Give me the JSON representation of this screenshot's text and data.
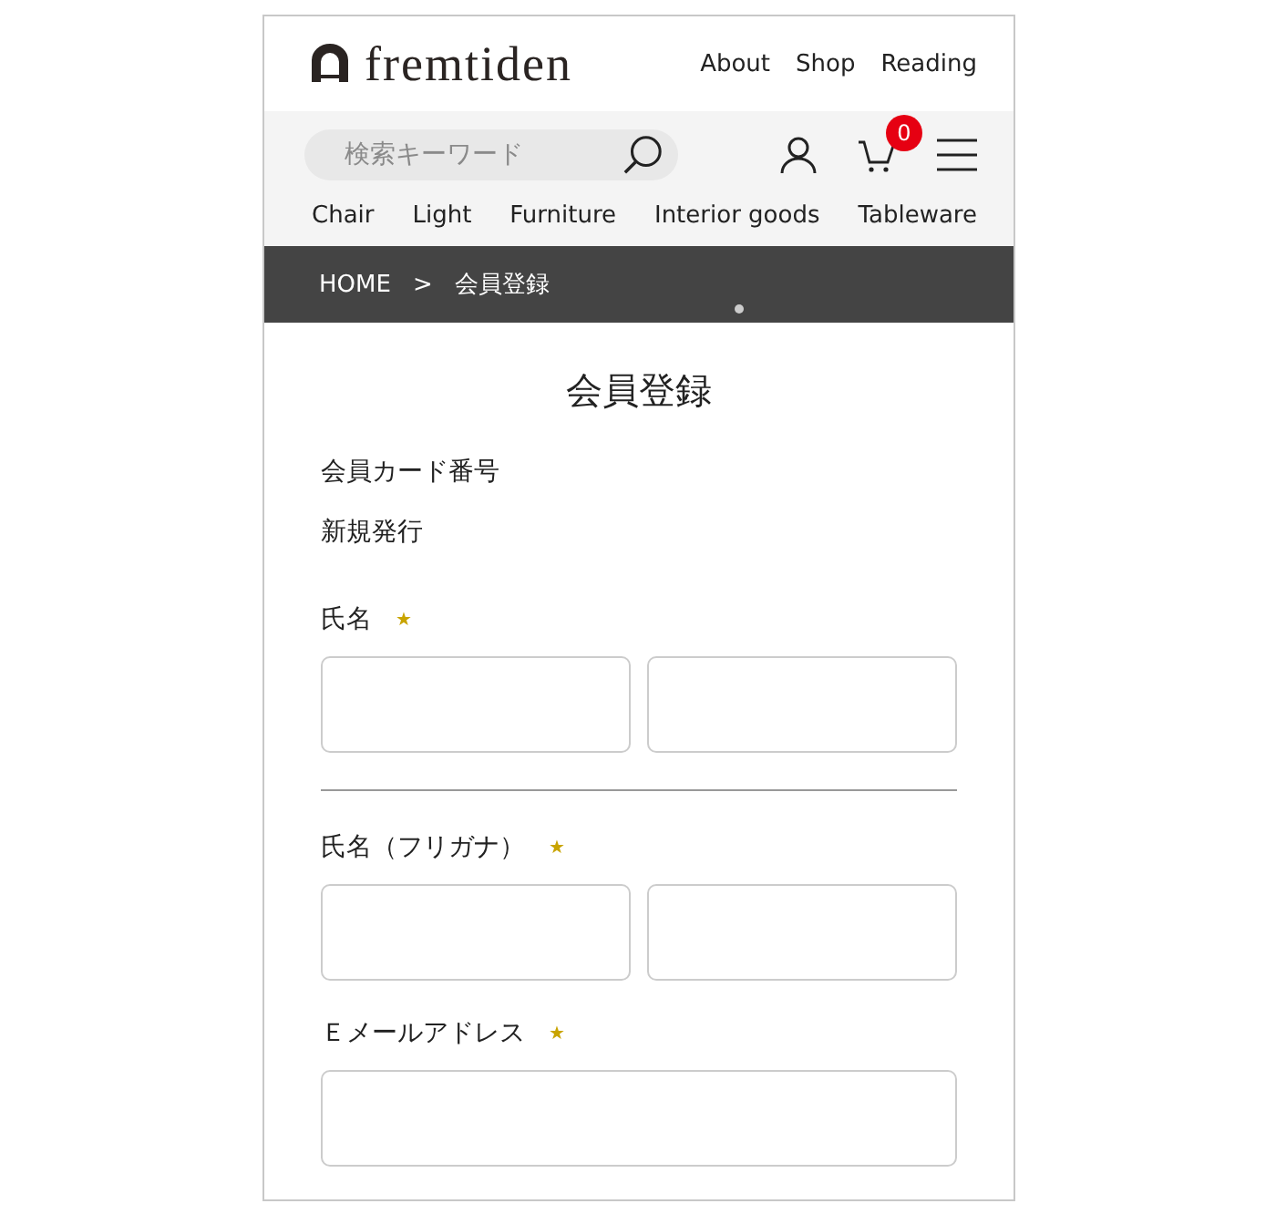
{
  "header": {
    "logo": "fremtiden",
    "nav": [
      "About",
      "Shop",
      "Reading"
    ]
  },
  "search": {
    "placeholder": "検索キーワード"
  },
  "cart": {
    "count": "0"
  },
  "categories": [
    "Chair",
    "Light",
    "Furniture",
    "Interior goods",
    "Tableware"
  ],
  "breadcrumb": [
    "HOME",
    ">",
    "会員登録"
  ],
  "page_title": "会員登録",
  "form": [
    {
      "kind": "info",
      "label": "会員カード番号",
      "value": "新規発行"
    },
    {
      "kind": "pair",
      "label": "氏名",
      "required_mark": "★"
    },
    {
      "kind": "divider"
    },
    {
      "kind": "pair",
      "label": "氏名（フリガナ）",
      "required_mark": "★"
    },
    {
      "kind": "single",
      "label": "Ｅメールアドレス",
      "required_mark": "★"
    }
  ]
}
